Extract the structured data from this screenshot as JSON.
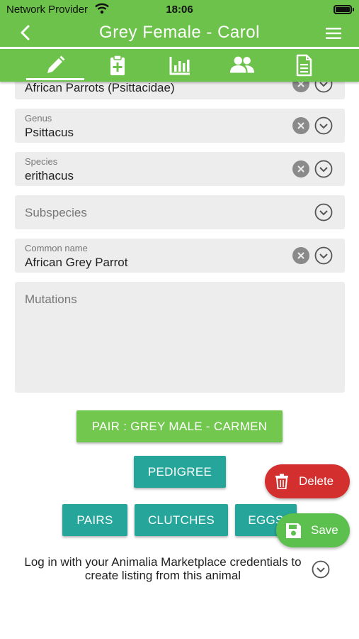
{
  "status": {
    "provider": "Network Provider",
    "time": "18:06"
  },
  "header": {
    "title": "Grey Female - Carol"
  },
  "tabs": [
    {
      "icon": "pencil-icon",
      "active": true
    },
    {
      "icon": "clipboard-plus-icon",
      "active": false
    },
    {
      "icon": "bar-chart-icon",
      "active": false
    },
    {
      "icon": "people-icon",
      "active": false
    },
    {
      "icon": "document-icon",
      "active": false
    }
  ],
  "form": {
    "family": {
      "value": "African Parrots (Psittacidae)"
    },
    "genus": {
      "label": "Genus",
      "value": "Psittacus"
    },
    "species": {
      "label": "Species",
      "value": "erithacus"
    },
    "subspecies": {
      "placeholder": "Subspecies"
    },
    "common_name": {
      "label": "Common name",
      "value": "African Grey Parrot"
    },
    "mutations": {
      "placeholder": "Mutations"
    }
  },
  "actions": {
    "pair": "PAIR : GREY MALE - CARMEN",
    "pedigree": "PEDIGREE",
    "pairs": "PAIRS",
    "clutches": "CLUTCHES",
    "eggs": "EGGS",
    "delete": "Delete",
    "save": "Save"
  },
  "login_text": "Log in with your Animalia Marketplace credentials to create listing from this animal",
  "colors": {
    "primary_green": "#6cc24a",
    "teal": "#26a69a",
    "delete_red": "#d32f2f"
  }
}
